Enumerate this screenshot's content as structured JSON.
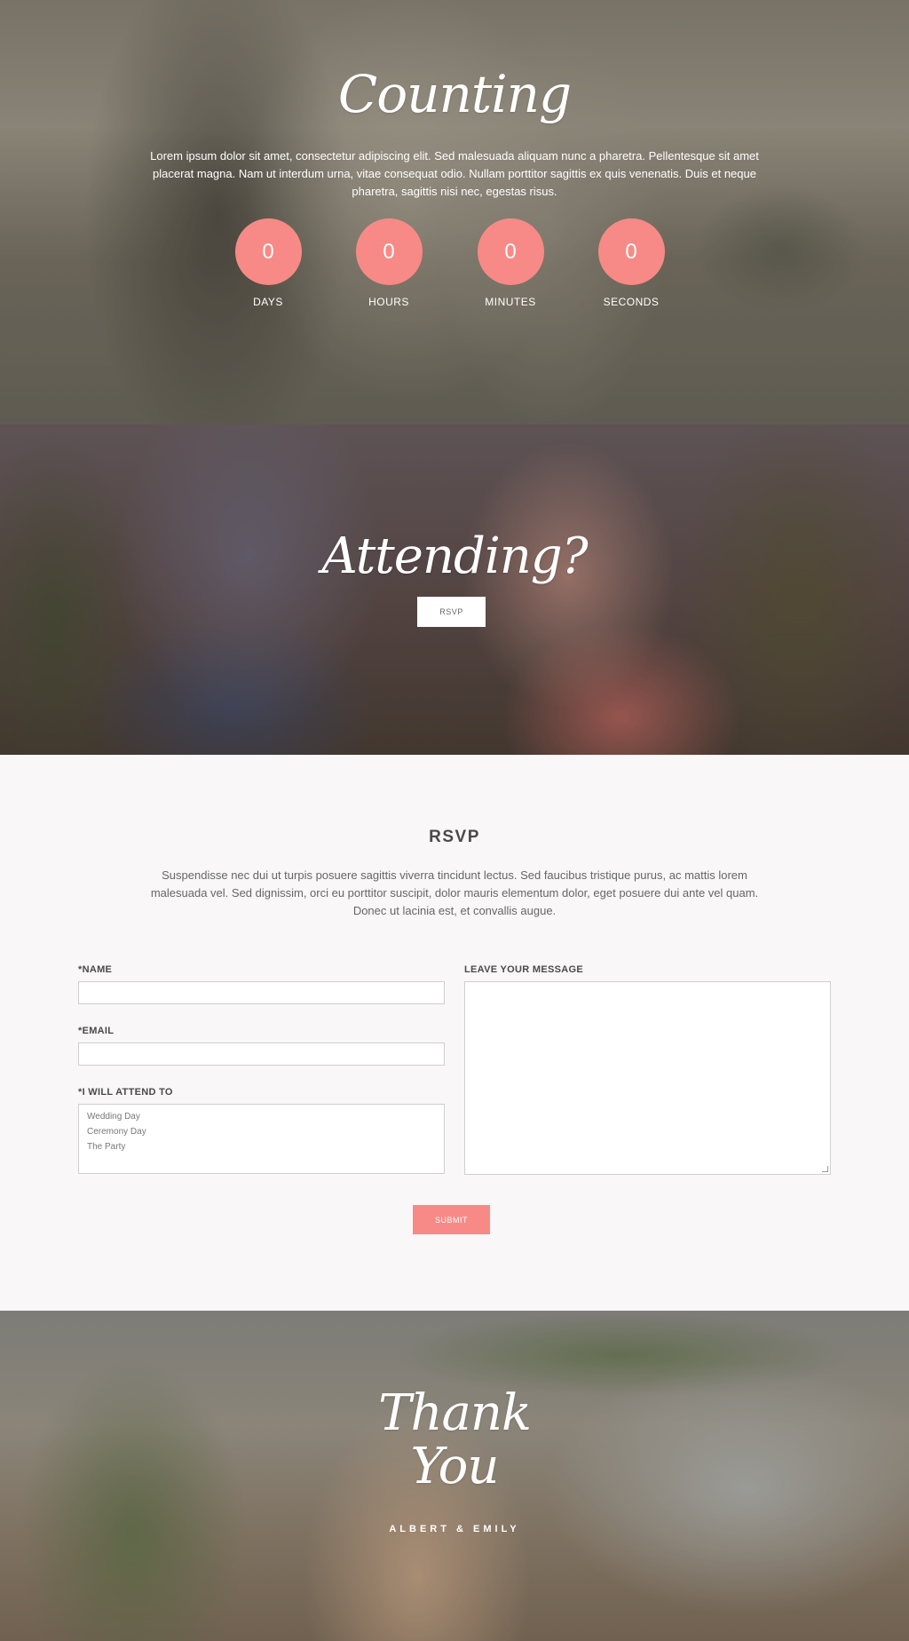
{
  "countdown_section": {
    "title": "Counting",
    "description": "Lorem ipsum dolor sit amet, consectetur adipiscing elit. Sed malesuada aliquam nunc a pharetra. Pellentesque sit amet placerat magna. Nam ut interdum urna, vitae consequat odio. Nullam porttitor sagittis ex quis venenatis. Duis et neque pharetra, sagittis nisi nec, egestas risus.",
    "units": [
      {
        "value": "0",
        "label": "DAYS"
      },
      {
        "value": "0",
        "label": "HOURS"
      },
      {
        "value": "0",
        "label": "MINUTES"
      },
      {
        "value": "0",
        "label": "SECONDS"
      }
    ],
    "accent_color": "#f78a86"
  },
  "attending_section": {
    "title": "Attending?",
    "button_label": "RSVP"
  },
  "rsvp_section": {
    "heading": "RSVP",
    "intro": "Suspendisse nec dui ut turpis posuere sagittis viverra tincidunt lectus. Sed faucibus tristique purus, ac mattis lorem malesuada vel. Sed dignissim, orci eu porttitor suscipit, dolor mauris elementum dolor, eget posuere dui ante vel quam. Donec ut lacinia est, et convallis augue.",
    "form": {
      "name_label": "*NAME",
      "name_value": "",
      "email_label": "*EMAIL",
      "email_value": "",
      "attend_label": "*I WILL ATTEND TO",
      "attend_options": [
        "Wedding Day",
        "Ceremony Day",
        "The Party"
      ],
      "message_label": "LEAVE YOUR MESSAGE",
      "message_value": "",
      "submit_label": "SUBMIT"
    }
  },
  "thanks_section": {
    "title_line1": "Thank",
    "title_line2": "You",
    "couple_names": "ALBERT & EMILY"
  }
}
